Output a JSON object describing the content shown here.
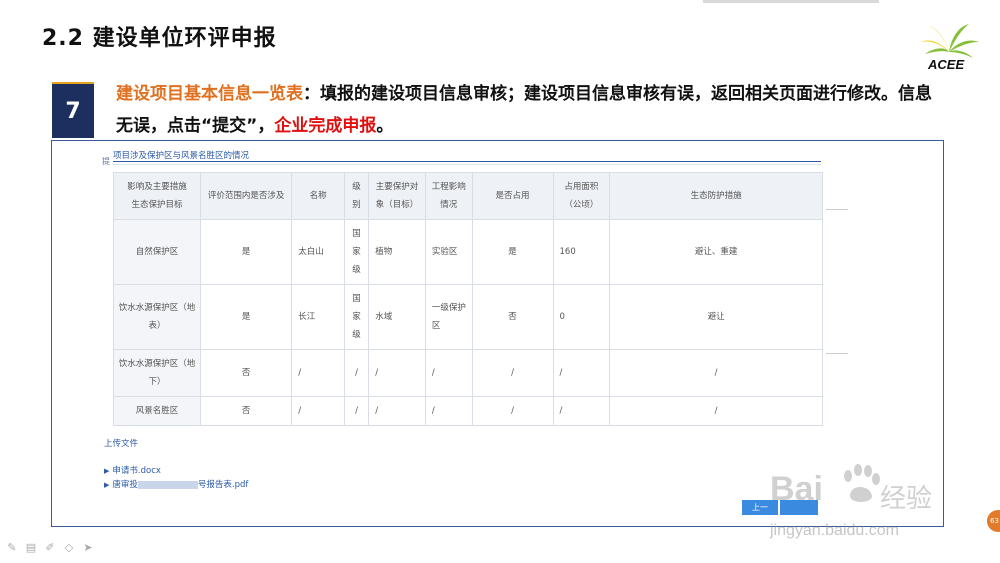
{
  "slide": {
    "title": "2.2  建设单位环评申报",
    "logo_text": "ACEE",
    "step_number": "7",
    "desc_part1": "建设项目基本信息一览表",
    "desc_part2": "：填报的建设项目信息审核；建设项目信息审核有误，返回相关页面进行修改。信息无误，点击“提交”，",
    "desc_part3": "企业完成申报",
    "desc_part4": "。"
  },
  "form": {
    "frame_tick": "提",
    "section_title": "项目涉及保护区与风景名胜区的情况",
    "headers": [
      "影响及主要措施\n生态保护目标",
      "评价范围内是否涉及",
      "名称",
      "级\n别",
      "主要保护对\n象（目标）",
      "工程影响\n情况",
      "是否占用",
      "占用面积\n（公顷）",
      "生态防护措施"
    ],
    "rows": [
      [
        "自然保护区",
        "是",
        "太白山",
        "国\n家\n级",
        "植物",
        "实验区",
        "是",
        "160",
        "避让、重建"
      ],
      [
        "饮水水源保护区（地\n表）",
        "是",
        "长江",
        "国\n家\n级",
        "水域",
        "一级保护\n区",
        "否",
        "0",
        "避让"
      ],
      [
        "饮水水源保护区（地\n下）",
        "否",
        "/",
        "/",
        "/",
        "/",
        "/",
        "/",
        "/"
      ],
      [
        "风景名胜区",
        "否",
        "/",
        "/",
        "/",
        "/",
        "/",
        "/",
        "/"
      ]
    ],
    "upload_title": "上传文件",
    "files": [
      "申请书.docx",
      "唐审投",
      "号报告表.pdf"
    ],
    "prev_label": "上一"
  },
  "watermark": {
    "brand": "Bai",
    "brand_cn": "经验",
    "url": "jingyan.baidu.com"
  },
  "page_badge": "63",
  "colors": {
    "accent_orange": "#e0701f",
    "accent_red": "#e01010",
    "step_box": "#1d2f5e",
    "link_blue": "#2a5aa8"
  }
}
